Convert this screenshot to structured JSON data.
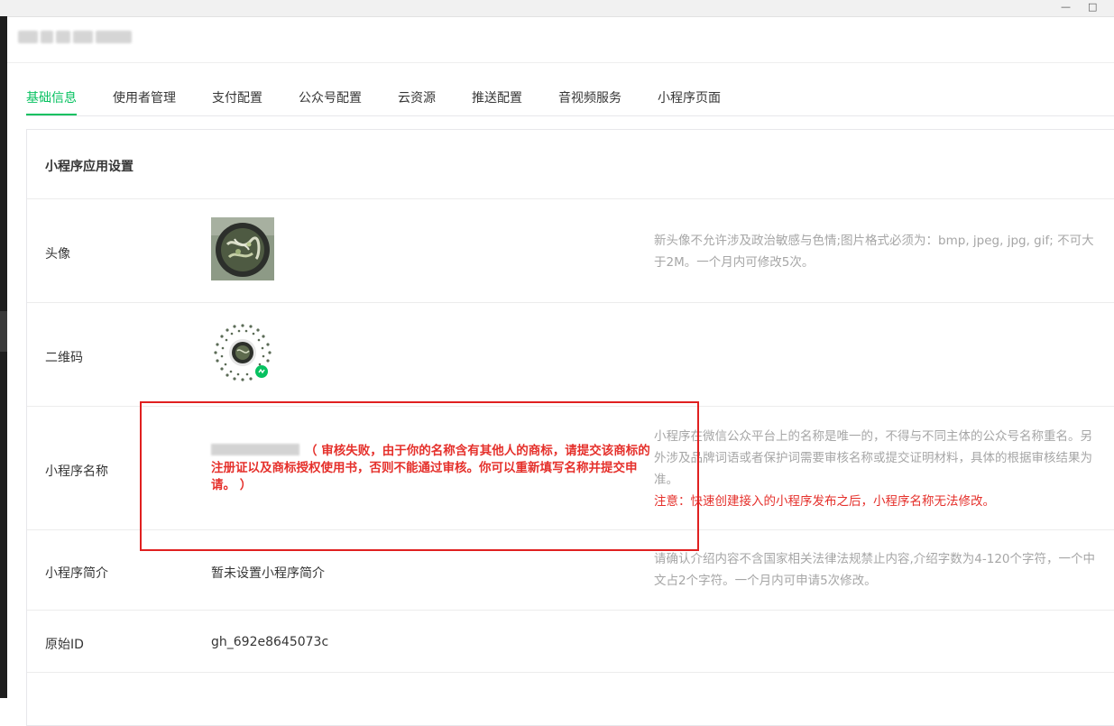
{
  "tabs": [
    {
      "label": "基础信息",
      "active": true
    },
    {
      "label": "使用者管理"
    },
    {
      "label": "支付配置"
    },
    {
      "label": "公众号配置"
    },
    {
      "label": "云资源"
    },
    {
      "label": "推送配置"
    },
    {
      "label": "音视频服务"
    },
    {
      "label": "小程序页面"
    }
  ],
  "card": {
    "title": "小程序应用设置",
    "rows": {
      "avatar": {
        "label": "头像",
        "tip": "新头像不允许涉及政治敏感与色情;图片格式必须为：bmp, jpeg, jpg, gif; 不可大于2M。一个月内可修改5次。"
      },
      "qrcode": {
        "label": "二维码"
      },
      "name": {
        "label": "小程序名称",
        "error": "（ 审核失败，由于你的名称含有其他人的商标，请提交该商标的注册证以及商标授权使用书，否则不能通过审核。你可以重新填写名称并提交申请。 ）",
        "tip": "小程序在微信公众平台上的名称是唯一的，不得与不同主体的公众号名称重名。另外涉及品牌词语或者保护词需要审核名称或提交证明材料，具体的根据审核结果为准。",
        "tip_warn": "注意：快速创建接入的小程序发布之后，小程序名称无法修改。"
      },
      "intro": {
        "label": "小程序简介",
        "value": "暂未设置小程序简介",
        "tip": "请确认介绍内容不含国家相关法律法规禁止内容,介绍字数为4-120个字符，一个中文占2个字符。一个月内可申请5次修改。"
      },
      "original_id": {
        "label": "原始ID",
        "value": "gh_692e8645073c"
      }
    }
  },
  "colors": {
    "accent": "#07c160",
    "error": "#e5302b",
    "tip": "#a6a6a6",
    "highlight_box": "#e02020"
  }
}
